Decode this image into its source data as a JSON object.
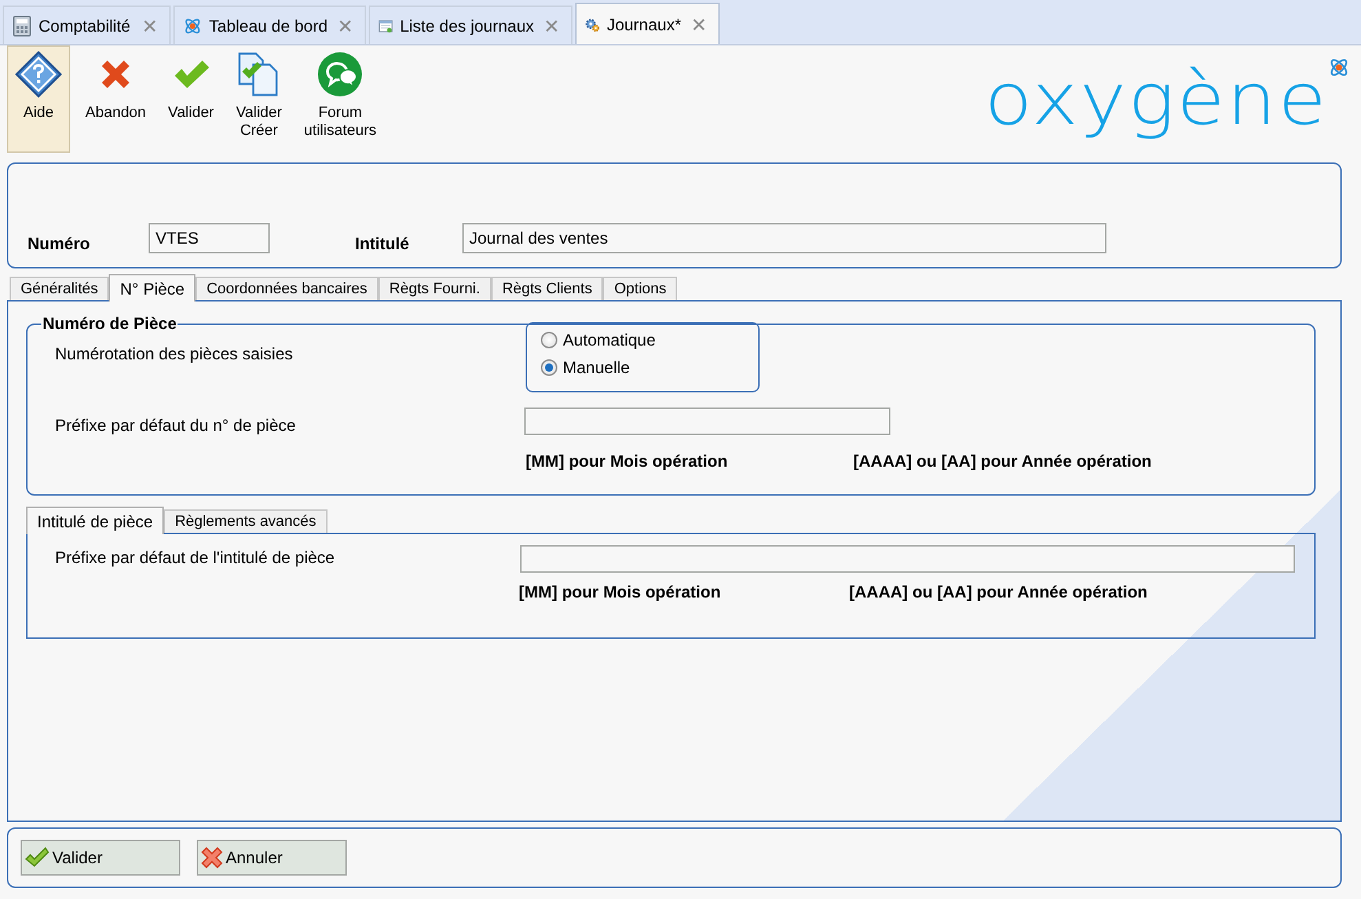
{
  "doc_tabs": [
    {
      "label": "Comptabilité",
      "selected": false
    },
    {
      "label": "Tableau de bord",
      "selected": false
    },
    {
      "label": "Liste des journaux",
      "selected": false
    },
    {
      "label": "Journaux*",
      "selected": true
    }
  ],
  "close_glyph": "✕",
  "toolbar": [
    {
      "label": "Aide",
      "selected": true
    },
    {
      "label": "Abandon",
      "selected": false
    },
    {
      "label": "Valider",
      "selected": false
    },
    {
      "label": "Valider Créer",
      "selected": false
    },
    {
      "label": "Forum utilisateurs",
      "selected": false
    }
  ],
  "logo": {
    "text": "oxygène"
  },
  "header": {
    "fields": [
      {
        "label": "Numéro",
        "value": "VTES"
      },
      {
        "label": "Intitulé",
        "value": "Journal des ventes"
      }
    ]
  },
  "tabs": [
    {
      "label": "Généralités",
      "selected": false
    },
    {
      "label": "N° Pièce",
      "selected": true
    },
    {
      "label": "Coordonnées bancaires",
      "selected": false
    },
    {
      "label": "Règts Fourni.",
      "selected": false
    },
    {
      "label": "Règts Clients",
      "selected": false
    },
    {
      "label": "Options",
      "selected": false
    }
  ],
  "piece_group": {
    "title": "Numéro de Pièce",
    "numbering_label": "Numérotation des pièces saisies",
    "options": [
      {
        "label": "Automatique",
        "selected": false
      },
      {
        "label": "Manuelle",
        "selected": true
      }
    ],
    "prefix_label": "Préfixe par défaut du n° de pièce",
    "hints": [
      "[MM] pour Mois opération",
      "[AAAA] ou [AA] pour Année opération"
    ]
  },
  "subtabs": [
    {
      "label": "Intitulé de pièce",
      "selected": true
    },
    {
      "label": "Règlements avancés",
      "selected": false
    }
  ],
  "subpanel": {
    "prefix_label": "Préfixe par défaut de l'intitulé de pièce",
    "hints": [
      "[MM] pour Mois opération",
      "[AAAA] ou [AA] pour Année opération"
    ]
  },
  "footer_buttons": [
    {
      "label": "Valider",
      "kind": "ok"
    },
    {
      "label": "Annuler",
      "kind": "cancel"
    }
  ]
}
